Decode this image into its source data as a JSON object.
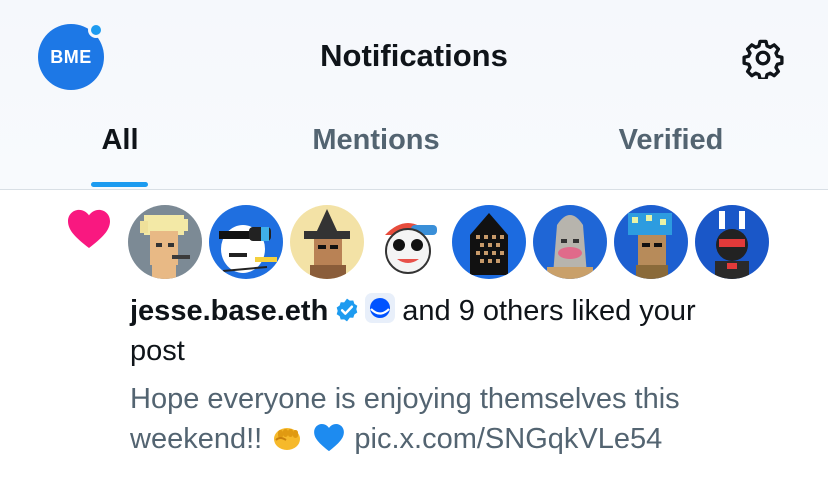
{
  "header": {
    "account_initials": "BME",
    "title": "Notifications"
  },
  "tabs": [
    {
      "label": "All",
      "active": true
    },
    {
      "label": "Mentions",
      "active": false
    },
    {
      "label": "Verified",
      "active": false
    }
  ],
  "notification": {
    "type_icon": "heart-icon",
    "liker_avatars": [
      "avatar-1",
      "avatar-2",
      "avatar-3",
      "avatar-4",
      "avatar-5",
      "avatar-6",
      "avatar-7",
      "avatar-8"
    ],
    "actor_name": "jesse.base.eth",
    "actor_verified": true,
    "action_text": "and 9 others liked your",
    "action_text_cont": "post",
    "post_preview": "Hope everyone is enjoying themselves this weekend!!",
    "post_link": "pic.x.com/SNGqkVLe54"
  },
  "colors": {
    "accent": "#1d9bf0",
    "heart": "#f91880",
    "secondary_text": "#536471"
  }
}
